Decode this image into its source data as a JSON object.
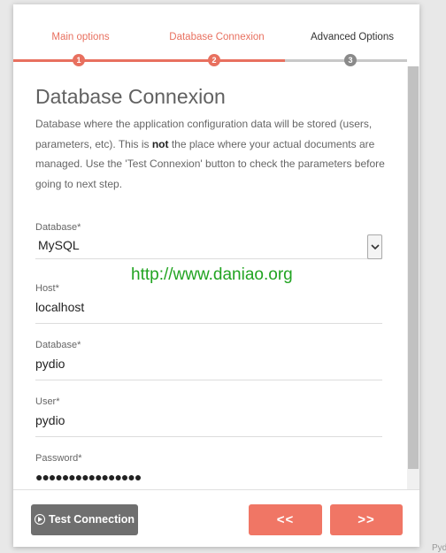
{
  "stepper": {
    "steps": [
      {
        "label": "Main options",
        "number": "1",
        "state": "done"
      },
      {
        "label": "Database Connexion",
        "number": "2",
        "state": "active"
      },
      {
        "label": "Advanced Options",
        "number": "3",
        "state": "todo"
      }
    ]
  },
  "colors": {
    "accent": "#e8705f",
    "inactive": "#c8c8c8",
    "button_gray": "#6f6f6f",
    "button_accent": "#f07665",
    "watermark": "#22a422"
  },
  "page": {
    "title": "Database Connexion",
    "description_part1": "Database where the application configuration data will be stored (users, parameters, etc). This is ",
    "description_bold": "not",
    "description_part2": " the place where your actual documents are managed. Use the 'Test Connexion' button to check the parameters before going to next step."
  },
  "form": {
    "database_type": {
      "label": "Database*",
      "value": "MySQL"
    },
    "host": {
      "label": "Host*",
      "value": "localhost"
    },
    "database": {
      "label": "Database*",
      "value": "pydio"
    },
    "user": {
      "label": "User*",
      "value": "pydio"
    },
    "password": {
      "label": "Password*",
      "value": "●●●●●●●●●●●●●●●●"
    }
  },
  "footer": {
    "test_label": "Test Connection",
    "prev_label": "<<",
    "next_label": ">>"
  },
  "watermark": "http://www.daniao.org",
  "corner_text": "Pyd"
}
